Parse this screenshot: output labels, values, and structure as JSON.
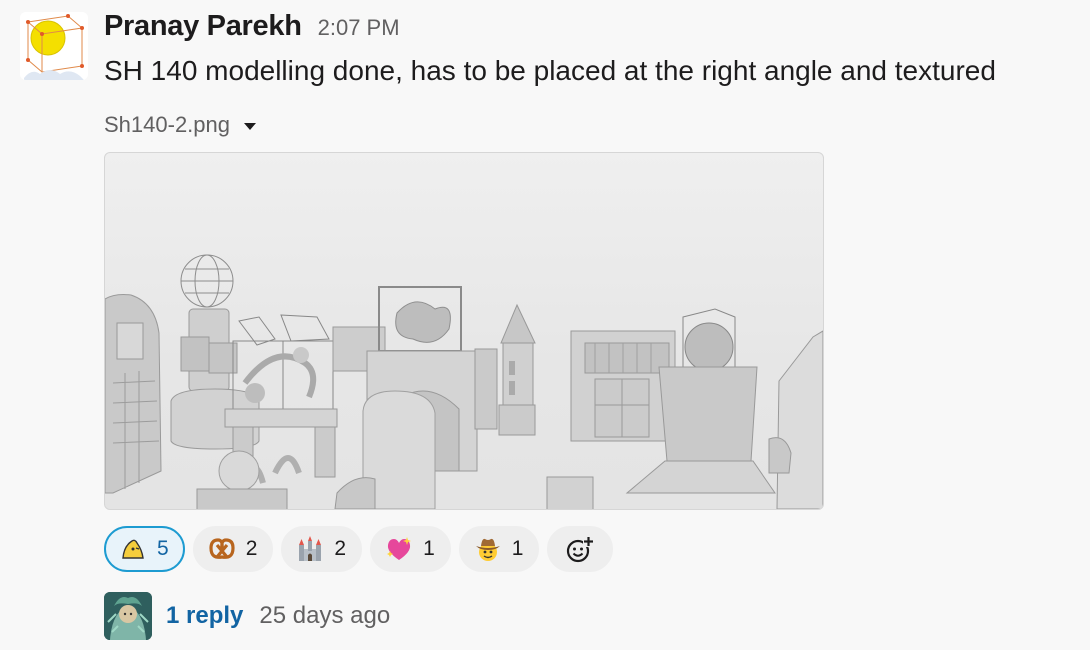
{
  "message": {
    "sender": "Pranay Parekh",
    "timestamp": "2:07 PM",
    "text": "SH 140 modelling done, has to be placed at the right angle and textured",
    "attachment": {
      "file_name": "Sh140-2.png",
      "icon": "chevron-down-icon"
    }
  },
  "reactions": [
    {
      "emoji": "custom-yellow-blob-emoji",
      "count": "5",
      "active": true
    },
    {
      "emoji": "pretzel-emoji",
      "count": "2",
      "active": false
    },
    {
      "emoji": "castle-emoji",
      "count": "2",
      "active": false
    },
    {
      "emoji": "sparkling-heart-emoji",
      "count": "1",
      "active": false
    },
    {
      "emoji": "cowboy-face-emoji",
      "count": "1",
      "active": false
    }
  ],
  "add_reaction_icon": "add-reaction-icon",
  "thread": {
    "reply_label": "1 reply",
    "last_reply": "25 days ago"
  },
  "colors": {
    "link": "#1264a3",
    "active_reaction_border": "#1d9bd1",
    "background": "#f8f8f8"
  }
}
